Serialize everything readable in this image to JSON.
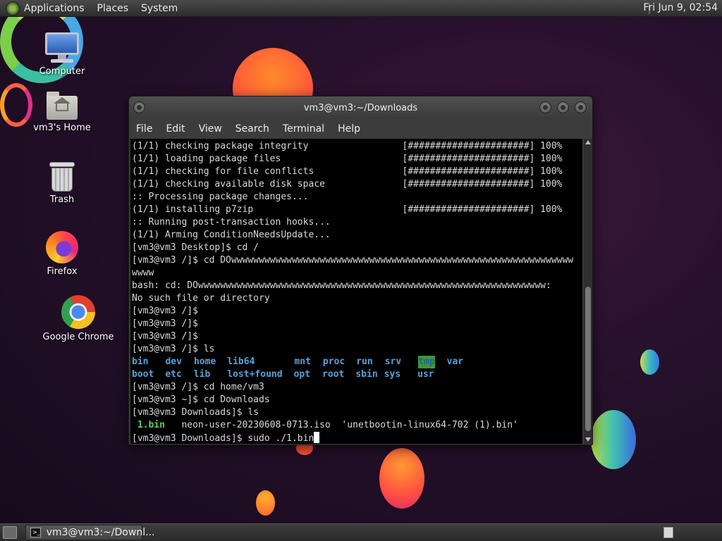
{
  "top_panel": {
    "menus": [
      "Applications",
      "Places",
      "System"
    ],
    "clock": "Fri Jun  9, 02:54"
  },
  "desktop_icons": {
    "computer": "Computer",
    "home": "vm3's Home",
    "trash": "Trash",
    "firefox": "Firefox",
    "chrome": "Google Chrome"
  },
  "terminal": {
    "title": "vm3@vm3:~/Downloads",
    "menus": [
      "File",
      "Edit",
      "View",
      "Search",
      "Terminal",
      "Help"
    ],
    "lines_before_ls": [
      "(1/1) checking package integrity                 [######################] 100%",
      "(1/1) loading package files                      [######################] 100%",
      "(1/1) checking for file conflicts                [######################] 100%",
      "(1/1) checking available disk space              [######################] 100%",
      ":: Processing package changes...",
      "(1/1) installing p7zip                           [######################] 100%",
      ":: Running post-transaction hooks...",
      "(1/1) Arming ConditionNeedsUpdate...",
      "[vm3@vm3 Desktop]$ cd /",
      "[vm3@vm3 /]$ cd DOwwwwwwwwwwwwwwwwwwwwwwwwwwwwwwwwwwwwwwwwwwwwwwwwwwwwwwwwwwwwww",
      "wwww",
      "bash: cd: DOwwwwwwwwwwwwwwwwwwwwwwwwwwwwwwwwwwwwwwwwwwwwwwwwwwwwwwwwwwwwwww:",
      "No such file or directory",
      "[vm3@vm3 /]$",
      "[vm3@vm3 /]$",
      "[vm3@vm3 /]$",
      "[vm3@vm3 /]$ ls"
    ],
    "ls_row1": [
      "bin",
      "dev",
      "home",
      "lib64",
      "mnt",
      "proc",
      "run",
      "srv",
      "tmp",
      "var"
    ],
    "ls_row2": [
      "boot",
      "etc",
      "lib",
      "lost+found",
      "opt",
      "root",
      "sbin",
      "sys",
      "usr"
    ],
    "lines_after_ls": [
      "[vm3@vm3 /]$ cd home/vm3",
      "[vm3@vm3 ~]$ cd Downloads",
      "[vm3@vm3 Downloads]$ ls"
    ],
    "downloads_ls": {
      "exe": "1.bin",
      "rest": "neon-user-20230608-0713.iso  'unetbootin-linux64-702 (1).bin'"
    },
    "prompt_line": "[vm3@vm3 Downloads]$ sudo ./1.bin"
  },
  "taskbar": {
    "task_label": "vm3@vm3:~/Downl..."
  }
}
